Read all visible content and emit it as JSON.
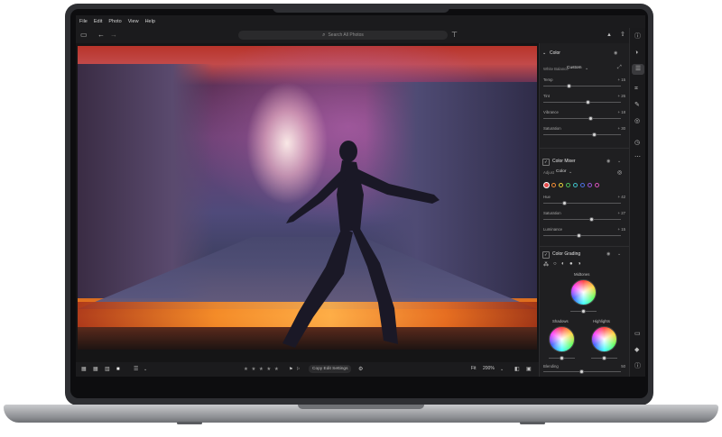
{
  "menu": [
    "File",
    "Edit",
    "Photo",
    "View",
    "Help"
  ],
  "search": {
    "placeholder": "Search All Photos"
  },
  "panel": {
    "color": {
      "title": "Color",
      "white_balance_label": "White Balance",
      "white_balance_value": "Custom",
      "sliders": [
        {
          "label": "Temp",
          "value": "+ 15",
          "level": 0.34
        },
        {
          "label": "Tint",
          "value": "+ 26",
          "level": 0.58
        },
        {
          "label": "Vibrance",
          "value": "+ 18",
          "level": 0.62
        },
        {
          "label": "Saturation",
          "value": "+ 30",
          "level": 0.66
        }
      ]
    },
    "color_mixer": {
      "title": "Color Mixer",
      "adjust_label": "Adjust",
      "adjust_value": "Color",
      "swatches": [
        "#e34b4b",
        "#f08b34",
        "#e6d13a",
        "#4cc15a",
        "#3fc1c9",
        "#4a6fe0",
        "#9a55d8",
        "#d850b8"
      ],
      "sliders": [
        {
          "label": "Hue",
          "value": "+ 42",
          "level": 0.28
        },
        {
          "label": "Saturation",
          "value": "+ 27",
          "level": 0.63
        },
        {
          "label": "Luminance",
          "value": "+ 15",
          "level": 0.46
        }
      ]
    },
    "color_grading": {
      "title": "Color Grading",
      "midtones": "Midtones",
      "shadows": "Shadows",
      "highlights": "Highlights",
      "blending_label": "Blending",
      "blending_value": "50",
      "blending_level": 0.5
    }
  },
  "filmstrip": {
    "stars": "★ ★ ★ ★ ★",
    "copy_button": "Copy Edit Settings",
    "fit": "Fit",
    "zoom": "200%"
  }
}
